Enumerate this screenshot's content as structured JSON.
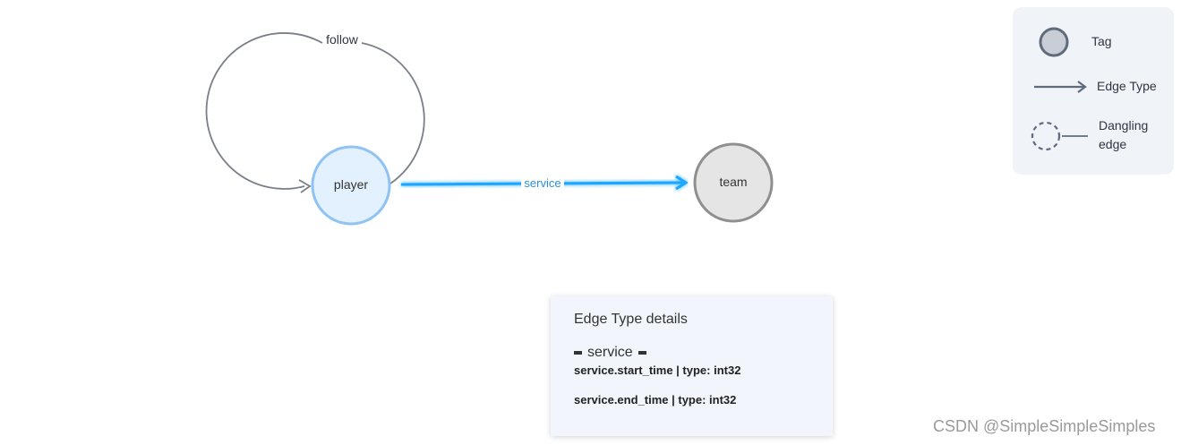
{
  "graph": {
    "nodes": {
      "player": "player",
      "team": "team"
    },
    "edges": {
      "self_loop": "follow",
      "link": "service"
    }
  },
  "legend": {
    "tag": "Tag",
    "edge_type": "Edge Type",
    "dangling_line1": "Dangling",
    "dangling_line2": "edge"
  },
  "details": {
    "title": "Edge Type details",
    "edge_name": "service",
    "properties": [
      "service.start_time | type: int32",
      "service.end_time | type: int32"
    ]
  },
  "watermark": "CSDN @SimpleSimpleSimples",
  "colors": {
    "player_fill": "#e3f0fd",
    "player_stroke": "#90c2f3",
    "team_fill": "#e5e5e5",
    "team_stroke": "#8f8f8f",
    "edge_highlight": "#1aa6ff",
    "loop_stroke": "#7a7f89",
    "legend_bg": "#f0f3f7",
    "details_bg": "#f2f5fb"
  }
}
